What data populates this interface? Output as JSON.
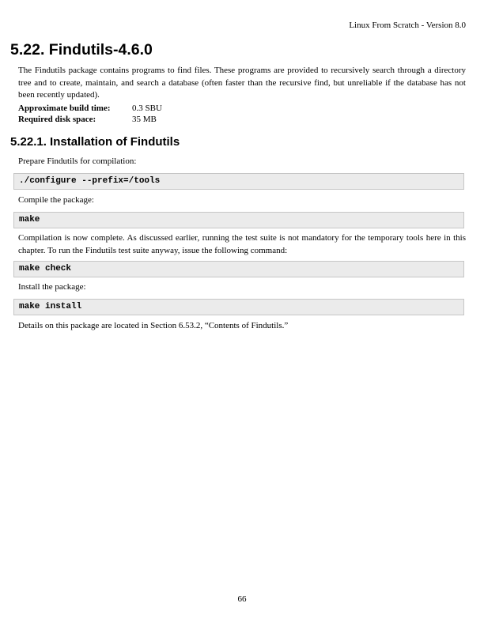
{
  "header": {
    "running_title": "Linux From Scratch - Version 8.0"
  },
  "section": {
    "title": "5.22. Findutils-4.6.0",
    "intro": "The Findutils package contains programs to find files. These programs are provided to recursively search through a directory tree and to create, maintain, and search a database (often faster than the recursive find, but unreliable if the database has not been recently updated).",
    "info": [
      {
        "label": "Approximate build time:",
        "value": "0.3 SBU"
      },
      {
        "label": "Required disk space:",
        "value": "35 MB"
      }
    ]
  },
  "subsection": {
    "title": "5.22.1. Installation of Findutils",
    "prepare_text": "Prepare Findutils for compilation:",
    "configure_cmd": "./configure --prefix=/tools",
    "compile_text": "Compile the package:",
    "make_cmd": "make",
    "test_text": "Compilation is now complete. As discussed earlier, running the test suite is not mandatory for the temporary tools here in this chapter. To run the Findutils test suite anyway, issue the following command:",
    "check_cmd": "make check",
    "install_text": "Install the package:",
    "install_cmd": "make install",
    "details_text": "Details on this package are located in Section 6.53.2, “Contents of Findutils.”"
  },
  "footer": {
    "page_number": "66"
  }
}
